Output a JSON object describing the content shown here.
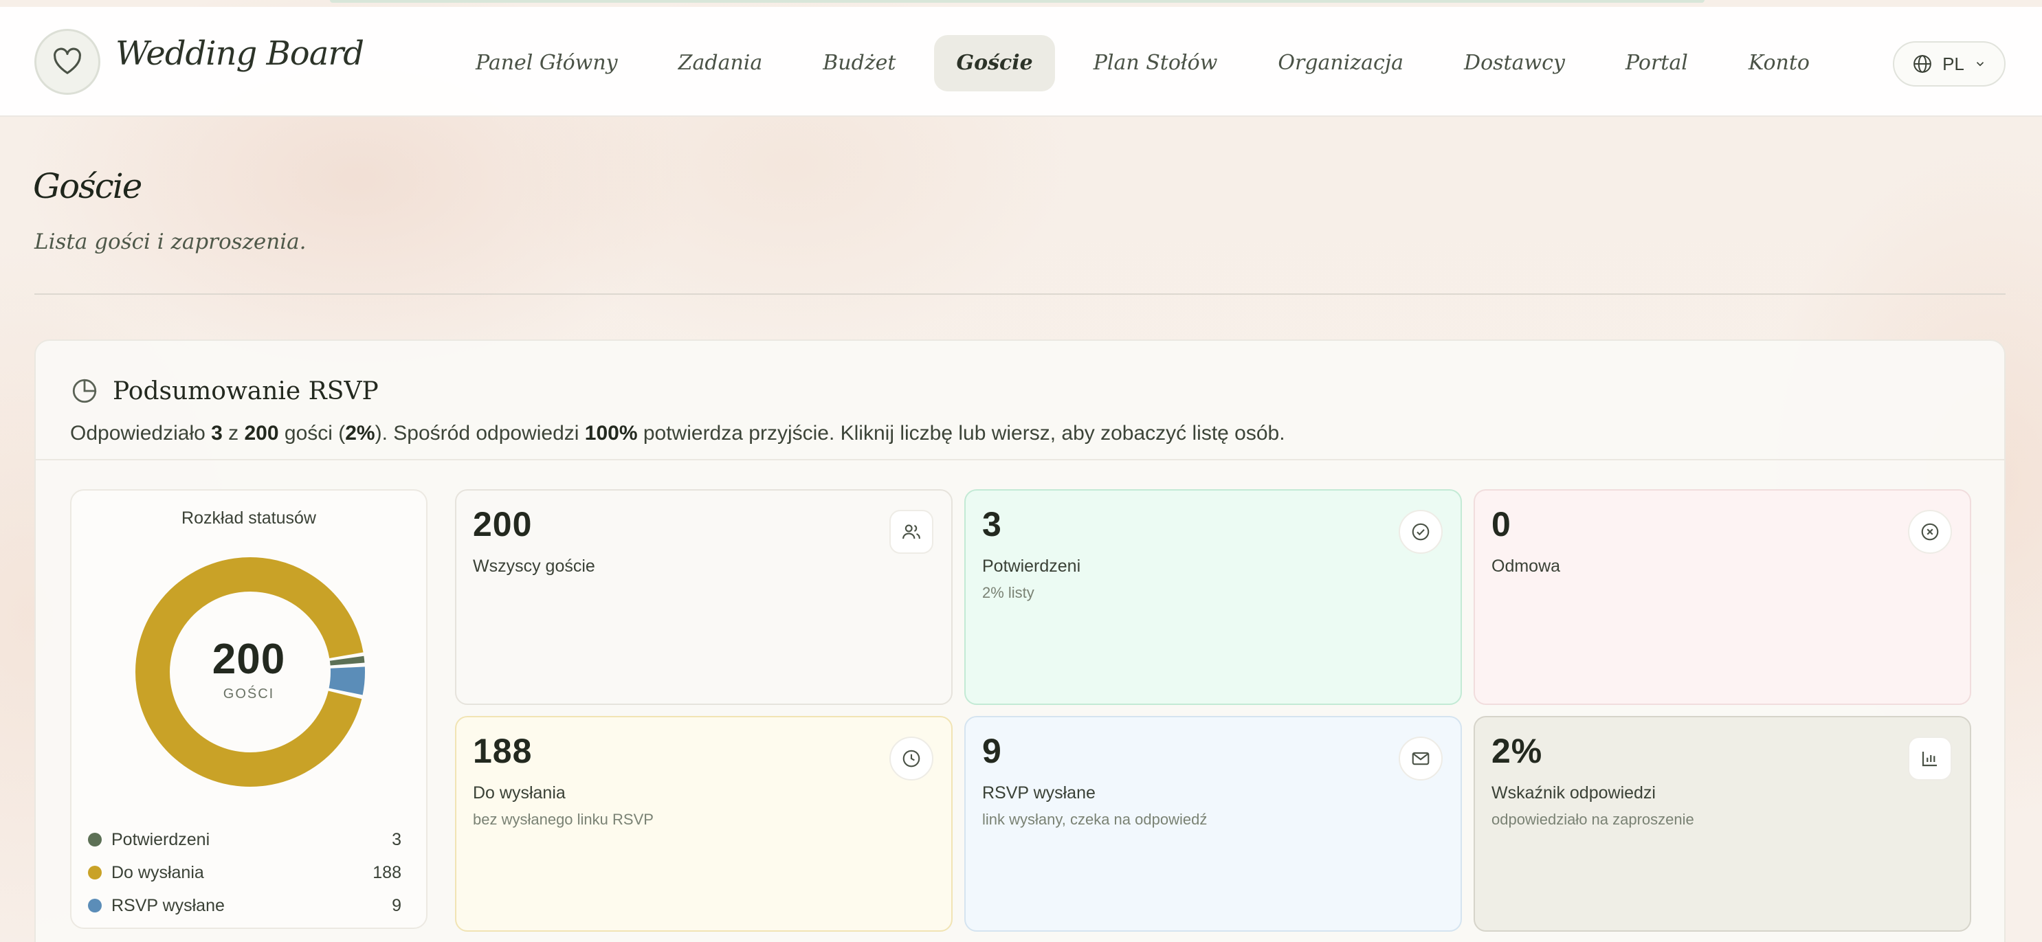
{
  "brand": {
    "name": "Wedding Board"
  },
  "nav": {
    "items": [
      {
        "label": "Panel Główny"
      },
      {
        "label": "Zadania"
      },
      {
        "label": "Budżet"
      },
      {
        "label": "Goście",
        "active": true
      },
      {
        "label": "Plan Stołów"
      },
      {
        "label": "Organizacja"
      },
      {
        "label": "Dostawcy"
      },
      {
        "label": "Portal"
      },
      {
        "label": "Konto"
      }
    ],
    "language": "PL"
  },
  "header": {
    "title": "Goście",
    "subtitle": "Lista gości i zaproszenia."
  },
  "rsvp": {
    "title": "Podsumowanie RSVP",
    "desc": {
      "p1": "Odpowiedziało ",
      "answered": "3",
      "p2": " z ",
      "total": "200",
      "p3": " gości (",
      "pct": "2%",
      "p4": "). Spośród odpowiedzi ",
      "confirm_pct": "100%",
      "p5": " potwierdza przyjście. Kliknij liczbę lub wiersz, aby zobaczyć listę osób."
    },
    "distribution": {
      "title": "Rozkład statusów",
      "center_value": "200",
      "center_label": "GOŚCI",
      "legend": [
        {
          "label": "Potwierdzeni",
          "value": "3",
          "count": 3,
          "color": "#5c7055"
        },
        {
          "label": "Do wysłania",
          "value": "188",
          "count": 188,
          "color": "#c9a227"
        },
        {
          "label": "RSVP wysłane",
          "value": "9",
          "count": 9,
          "color": "#5b8db8"
        }
      ]
    },
    "stats": [
      {
        "value": "200",
        "label": "Wszyscy goście",
        "sub": "",
        "icon": "users-icon",
        "bg": "#faf9f6",
        "border": "#e6e3dc"
      },
      {
        "value": "3",
        "label": "Potwierdzeni",
        "sub": "2% listy",
        "icon": "check-circle-icon",
        "bg": "#ecfbf3",
        "border": "#c3ead5"
      },
      {
        "value": "0",
        "label": "Odmowa",
        "sub": "",
        "icon": "x-circle-icon",
        "bg": "#fdf3f3",
        "border": "#f1dddd"
      },
      {
        "value": "188",
        "label": "Do wysłania",
        "sub": "bez wysłanego linku RSVP",
        "icon": "clock-icon",
        "bg": "#fefbee",
        "border": "#f1e4b4"
      },
      {
        "value": "9",
        "label": "RSVP wysłane",
        "sub": "link wysłany, czeka na odpowiedź",
        "icon": "mail-icon",
        "bg": "#f2f8fd",
        "border": "#d5e4f0"
      },
      {
        "value": "2%",
        "label": "Wskaźnik odpowiedzi",
        "sub": "odpowiedziało na zaproszenie",
        "icon": "bar-chart-icon",
        "bg": "#efeee6",
        "border": "#d6d4ca"
      }
    ]
  }
}
